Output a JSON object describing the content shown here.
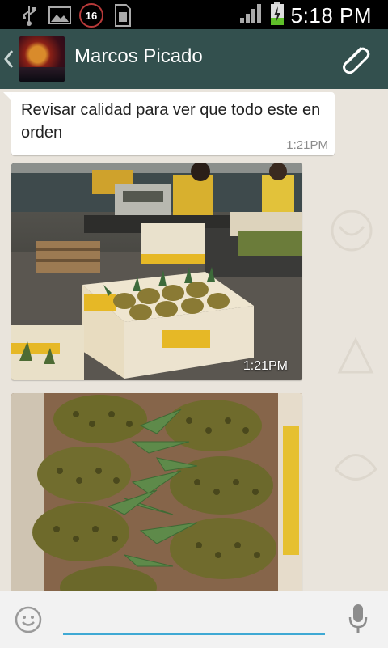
{
  "status_bar": {
    "time": "5:18 PM",
    "notification_count": "16",
    "icons": [
      "usb-icon",
      "image-icon",
      "notification-badge",
      "sim-icon",
      "signal-icon",
      "battery-charging-icon"
    ]
  },
  "header": {
    "contact_name": "Marcos Picado",
    "icons": [
      "back-chevron-icon",
      "avatar",
      "paperclip-icon"
    ]
  },
  "messages": [
    {
      "type": "text",
      "text": "Revisar calidad para ver que todo este en orden",
      "time": "1:21PM"
    },
    {
      "type": "image",
      "subject": "pineapple packing line",
      "time": "1:21PM"
    },
    {
      "type": "image",
      "subject": "pineapples in box",
      "time": ""
    }
  ],
  "input_bar": {
    "placeholder": "",
    "icons": [
      "emoji-icon",
      "microphone-icon"
    ]
  },
  "colors": {
    "action_bar": "#33504e",
    "chat_background": "#e9e4dc",
    "input_underline": "#3fa9d4"
  }
}
